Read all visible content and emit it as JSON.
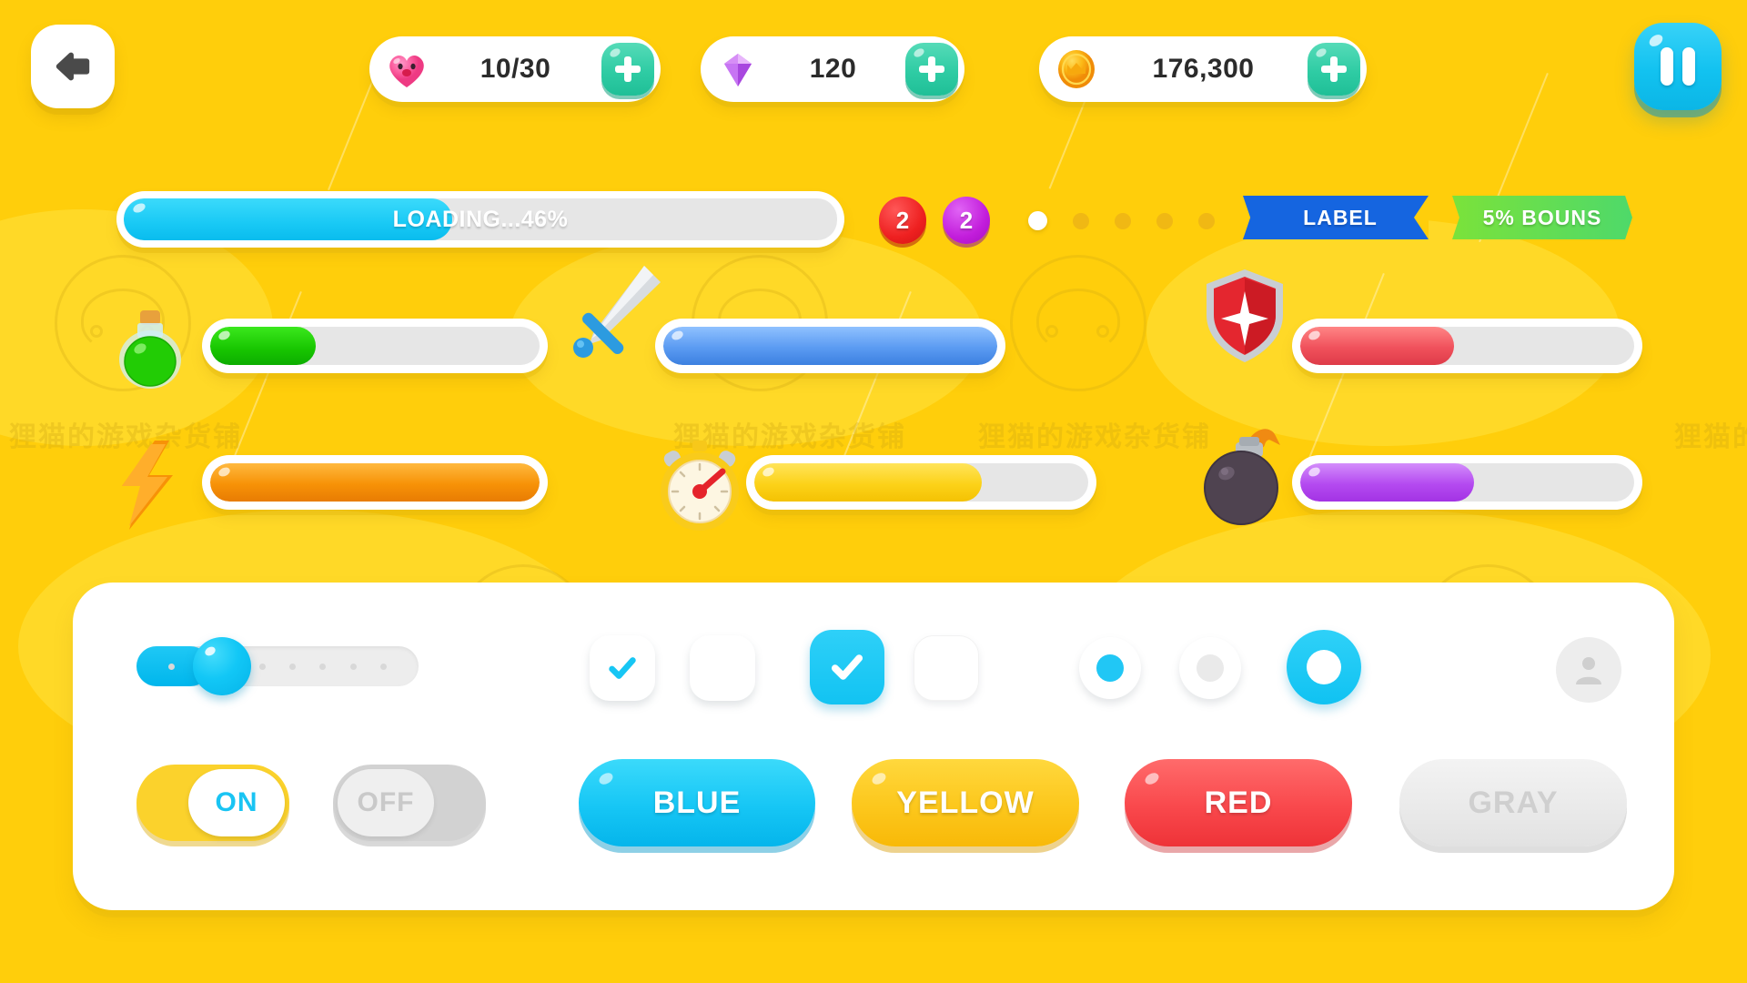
{
  "theme": {
    "background": "#FFCE0B",
    "accent_cyan": "#12C3F2",
    "accent_green": "#2FCCA4",
    "panel_white": "#FFFFFF"
  },
  "topbar": {
    "back_icon": "arrow-left-icon",
    "pause_icon": "pause-icon",
    "resources": [
      {
        "icon": "heart-icon",
        "value": "10/30",
        "plus_label": "+"
      },
      {
        "icon": "diamond-icon",
        "value": "120",
        "plus_label": "+"
      },
      {
        "icon": "coin-icon",
        "value": "176,300",
        "plus_label": "+"
      }
    ]
  },
  "loading": {
    "text": "LOADING...46%",
    "percent": 46,
    "fill_color": "#19C9F5",
    "track_color": "#D9D9D9"
  },
  "badges": [
    {
      "value": "2",
      "color": "#EE2020"
    },
    {
      "value": "2",
      "color": "#C21DDB"
    }
  ],
  "pagination": {
    "count": 5,
    "active_index": 0,
    "active_color": "#FFFFFF",
    "inactive_color": "#F0B814"
  },
  "ribbons": [
    {
      "text": "LABEL",
      "color": "#1565E0"
    },
    {
      "text": "5% BOUNS",
      "color": "#5EDC52"
    }
  ],
  "item_bars": [
    {
      "icon": "potion-icon",
      "percent": 32,
      "fill_color": "#20C900"
    },
    {
      "icon": "sword-icon",
      "percent": 100,
      "fill_color": "#5B9BF2"
    },
    {
      "icon": "shield-icon",
      "percent": 46,
      "fill_color": "#F0515C"
    },
    {
      "icon": "lightning-icon",
      "percent": 100,
      "fill_color": "#F79207"
    },
    {
      "icon": "stopwatch-icon",
      "percent": 68,
      "fill_color": "#FCD219"
    },
    {
      "icon": "bomb-icon",
      "percent": 52,
      "fill_color": "#B44AF0"
    }
  ],
  "controls": {
    "slider": {
      "value": 26,
      "knob_color": "#12C7F6",
      "fill_color": "#00B6EC"
    },
    "checkboxes": [
      {
        "state": "checked-light",
        "mark": "check-icon"
      },
      {
        "state": "unchecked",
        "mark": ""
      },
      {
        "state": "checked-solid",
        "mark": "check-icon"
      },
      {
        "state": "unchecked-outline",
        "mark": ""
      }
    ],
    "radios": [
      {
        "state": "selected",
        "inner_color": "#21C7F5"
      },
      {
        "state": "unselected",
        "inner_color": "#EAEAEA"
      },
      {
        "state": "ring",
        "inner_color": "#FFFFFF"
      }
    ],
    "toggles": [
      {
        "label": "ON",
        "state": "on"
      },
      {
        "label": "OFF",
        "state": "off"
      }
    ],
    "buttons": [
      {
        "label": "BLUE",
        "variant": "blue"
      },
      {
        "label": "YELLOW",
        "variant": "yellow"
      },
      {
        "label": "RED",
        "variant": "red"
      },
      {
        "label": "GRAY",
        "variant": "gray"
      }
    ]
  },
  "watermark": {
    "text": "狸猫的游戏杂货铺",
    "logo_icon": "cat-face-watermark-icon",
    "avatar_icon": "user-avatar-watermark-icon"
  }
}
